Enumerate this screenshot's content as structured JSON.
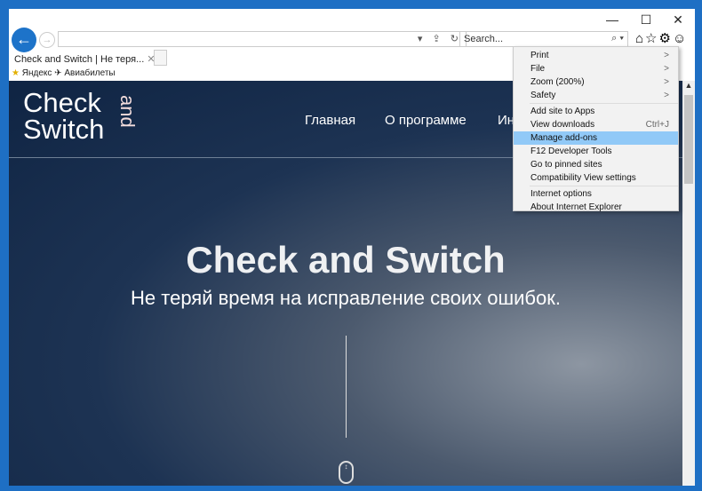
{
  "window": {
    "minimize": "—",
    "maximize": "☐",
    "close": "✕"
  },
  "toolbar": {
    "back": "←",
    "forward": "→",
    "address_value": "",
    "address_icons": "▾ ⇪ ↻",
    "search_placeholder": "Search...",
    "search_icon": "⌕ ▾",
    "tools": "⌂☆⚙☺"
  },
  "tab": {
    "title": "Check and Switch | Не теря...",
    "close": "✕"
  },
  "favorites": [
    {
      "label": "Яндекс"
    },
    {
      "label": "Авиабилеты"
    }
  ],
  "site": {
    "logo": {
      "line1": "Check",
      "line2": "Switch",
      "and": "and"
    },
    "nav": [
      "Главная",
      "О программе",
      "Ин"
    ],
    "title": "Check and Switch",
    "subtitle": "Не теряй время на исправление своих ошибок."
  },
  "menu": {
    "items": [
      {
        "label": "Print",
        "arrow": ">"
      },
      {
        "label": "File",
        "arrow": ">"
      },
      {
        "label": "Zoom (200%)",
        "arrow": ">"
      },
      {
        "label": "Safety",
        "arrow": ">"
      },
      {
        "label": "Add site to Apps"
      },
      {
        "label": "View downloads",
        "shortcut": "Ctrl+J"
      },
      {
        "label": "Manage add-ons",
        "highlighted": true
      },
      {
        "label": "F12 Developer Tools"
      },
      {
        "label": "Go to pinned sites"
      },
      {
        "label": "Compatibility View settings"
      },
      {
        "label": "Internet options"
      },
      {
        "label": "About Internet Explorer"
      }
    ]
  },
  "colors": {
    "frame": "#1e6fc4",
    "highlight": "#91c9f7"
  }
}
